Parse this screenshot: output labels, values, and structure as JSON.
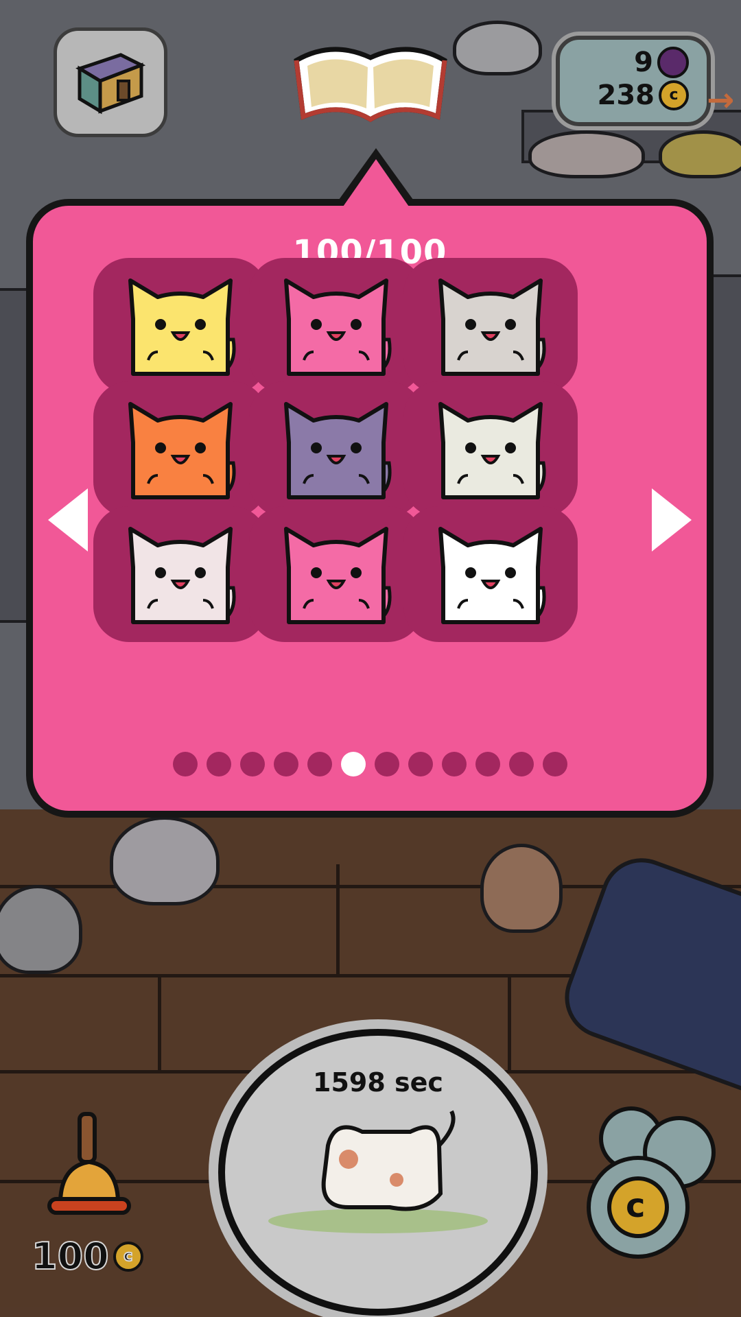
{
  "collection": {
    "count_label": "100/100",
    "cats": [
      {
        "name": "yellow-cat",
        "body": "#fbe46e"
      },
      {
        "name": "pink-heart-cat",
        "body": "#f46ba6"
      },
      {
        "name": "calico-spotted-cat",
        "body": "#d8d3cf"
      },
      {
        "name": "orange-tabby-cat",
        "body": "#f98141"
      },
      {
        "name": "purple-cloud-cat",
        "body": "#8b7aa8"
      },
      {
        "name": "olive-white-cat",
        "body": "#eaeae0"
      },
      {
        "name": "rainbow-cat",
        "body": "#f1e4e6"
      },
      {
        "name": "pink-cat",
        "body": "#f46ba6"
      },
      {
        "name": "headband-cat",
        "body": "#ffffff"
      }
    ],
    "page_count": 12,
    "current_page": 6
  },
  "currency": {
    "gems": "9",
    "coins": "238",
    "coin_symbol": "c"
  },
  "bell": {
    "price": "100",
    "coin_symbol": "c"
  },
  "timer": {
    "label": "1598 sec"
  },
  "treat": {
    "coin_symbol": "c"
  },
  "colors": {
    "panel": "#f15897",
    "slot": "#a3275f",
    "dot_active": "#ffffff"
  }
}
